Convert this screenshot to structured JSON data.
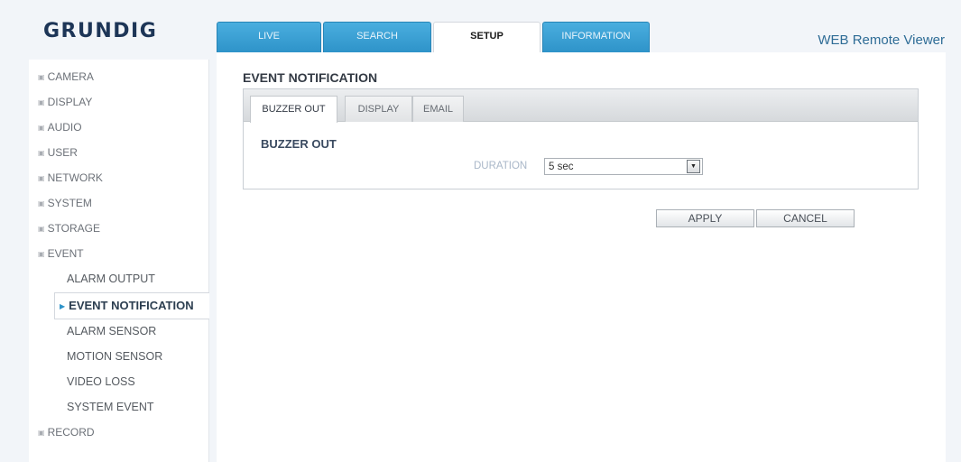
{
  "brand": {
    "logo": "GRUNDIG",
    "app_name": "WEB Remote Viewer"
  },
  "top_tabs": [
    {
      "label": "LIVE",
      "active": false
    },
    {
      "label": "SEARCH",
      "active": false
    },
    {
      "label": "SETUP",
      "active": true
    },
    {
      "label": "INFORMATION",
      "active": false
    }
  ],
  "sidebar": {
    "items": [
      {
        "label": "CAMERA"
      },
      {
        "label": "DISPLAY"
      },
      {
        "label": "AUDIO"
      },
      {
        "label": "USER"
      },
      {
        "label": "NETWORK"
      },
      {
        "label": "SYSTEM"
      },
      {
        "label": "STORAGE"
      },
      {
        "label": "EVENT",
        "expanded": true
      },
      {
        "label": "RECORD"
      }
    ],
    "event_subitems": [
      {
        "label": "ALARM OUTPUT"
      },
      {
        "label": "EVENT NOTIFICATION",
        "active": true
      },
      {
        "label": "ALARM SENSOR"
      },
      {
        "label": "MOTION SENSOR"
      },
      {
        "label": "VIDEO LOSS"
      },
      {
        "label": "SYSTEM EVENT"
      }
    ]
  },
  "main": {
    "title": "EVENT NOTIFICATION",
    "subtabs": [
      {
        "label": "BUZZER OUT",
        "active": true
      },
      {
        "label": "DISPLAY",
        "active": false
      },
      {
        "label": "EMAIL",
        "active": false
      }
    ],
    "section_title": "BUZZER OUT",
    "duration": {
      "label": "DURATION",
      "value": "5 sec"
    },
    "buttons": {
      "apply": "APPLY",
      "cancel": "CANCEL"
    }
  },
  "icons": {
    "menu_bullet": "square-bullet-icon",
    "active_marker": "triangle-right-icon",
    "dropdown": "dropdown-arrow-icon"
  },
  "colors": {
    "accent": "#2e93c9",
    "logo": "#1d3557",
    "app_name": "#2e6c96"
  }
}
